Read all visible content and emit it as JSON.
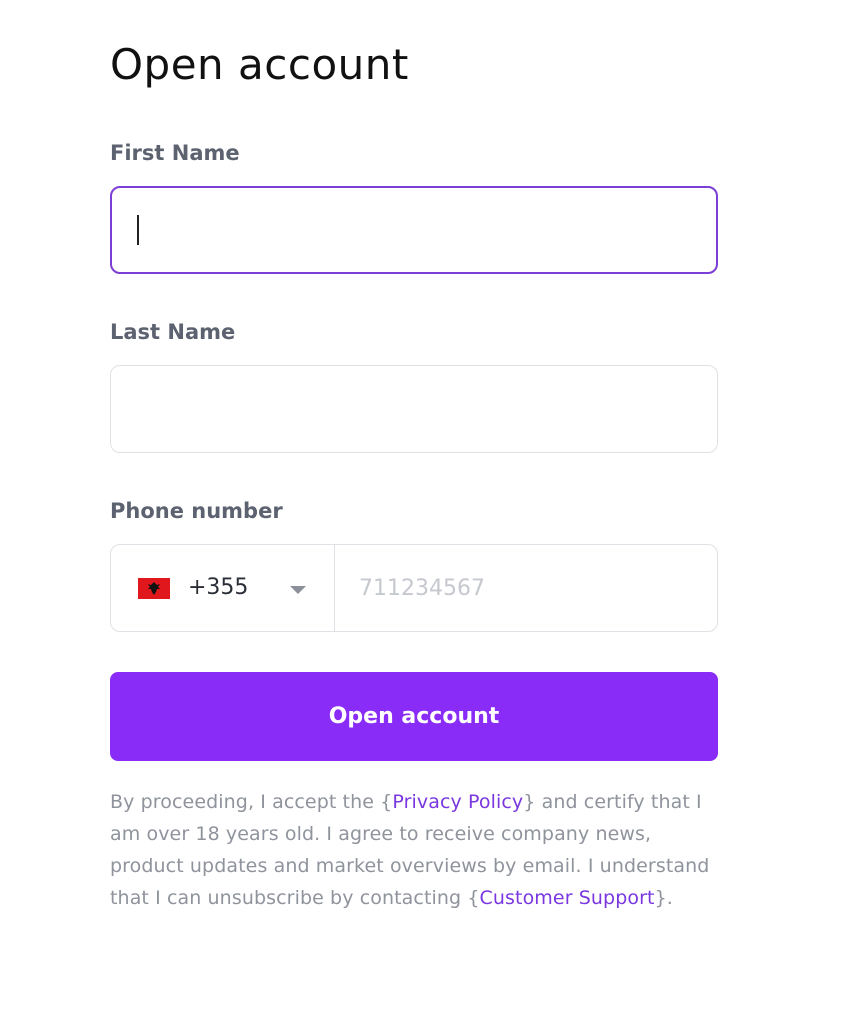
{
  "page": {
    "title": "Open account"
  },
  "form": {
    "first_name": {
      "label": "First Name",
      "value": ""
    },
    "last_name": {
      "label": "Last Name",
      "value": ""
    },
    "phone": {
      "label": "Phone number",
      "country_code": "+355",
      "flag_icon": "albania-flag-icon",
      "placeholder": "711234567",
      "value": ""
    },
    "submit_label": "Open account"
  },
  "consent": {
    "part1": "By proceeding, I accept the {",
    "privacy_link": "Privacy Policy",
    "part2": "} and certify that I am over 18 years old. I agree to receive company news, product updates and market overviews by email. I understand that I can unsubscribe by contacting {",
    "support_link": "Customer Support",
    "part3": "}."
  },
  "colors": {
    "accent": "#8a2cf7",
    "focus_border": "#7c3fd6",
    "link": "#7a37e0",
    "muted_text": "#8f939c",
    "flag_red": "#e0171d"
  }
}
